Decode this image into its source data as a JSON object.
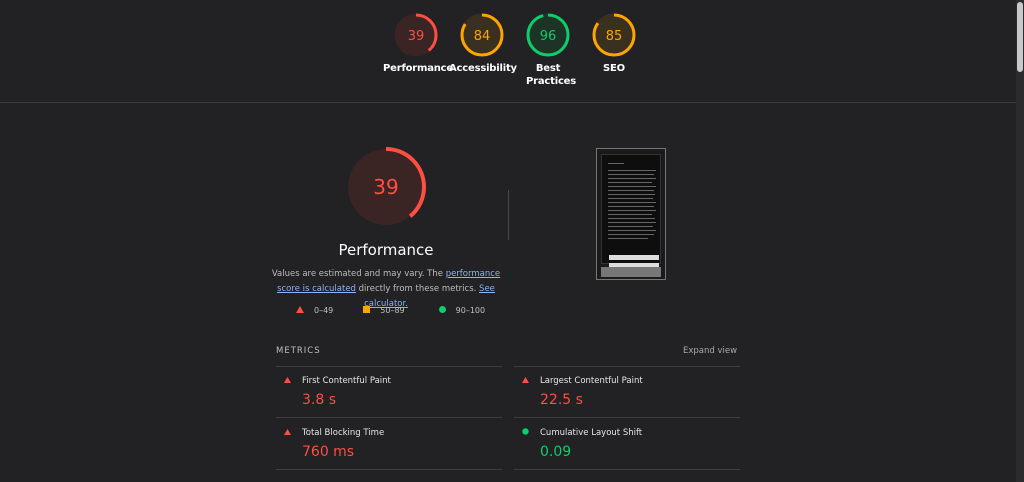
{
  "top_gauges": [
    {
      "score": "39",
      "label": "Performance",
      "status": "fail"
    },
    {
      "score": "84",
      "label": "Accessibility",
      "status": "average"
    },
    {
      "score": "96",
      "label": "Best Practices",
      "status": "pass"
    },
    {
      "score": "85",
      "label": "SEO",
      "status": "average"
    }
  ],
  "main": {
    "score": "39",
    "title": "Performance",
    "desc_before": "Values are estimated and may vary. The ",
    "desc_link1": "performance score is calculated",
    "desc_middle": " directly from these metrics. ",
    "desc_link2": "See calculator."
  },
  "legend": [
    {
      "range": "0–49",
      "icon": "triangle-icon"
    },
    {
      "range": "50–89",
      "icon": "square-icon"
    },
    {
      "range": "90–100",
      "icon": "circle-icon"
    }
  ],
  "metrics": {
    "heading": "METRICS",
    "expand_label": "Expand view",
    "items": [
      {
        "name": "First Contentful Paint",
        "value": "3.8 s",
        "status": "fail"
      },
      {
        "name": "Largest Contentful Paint",
        "value": "22.5 s",
        "status": "fail"
      },
      {
        "name": "Total Blocking Time",
        "value": "760 ms",
        "status": "fail"
      },
      {
        "name": "Cumulative Layout Shift",
        "value": "0.09",
        "status": "pass"
      }
    ]
  },
  "colors": {
    "fail": "#ff4e42",
    "average": "#ffa400",
    "pass": "#0cce6b",
    "background": "#222123"
  }
}
